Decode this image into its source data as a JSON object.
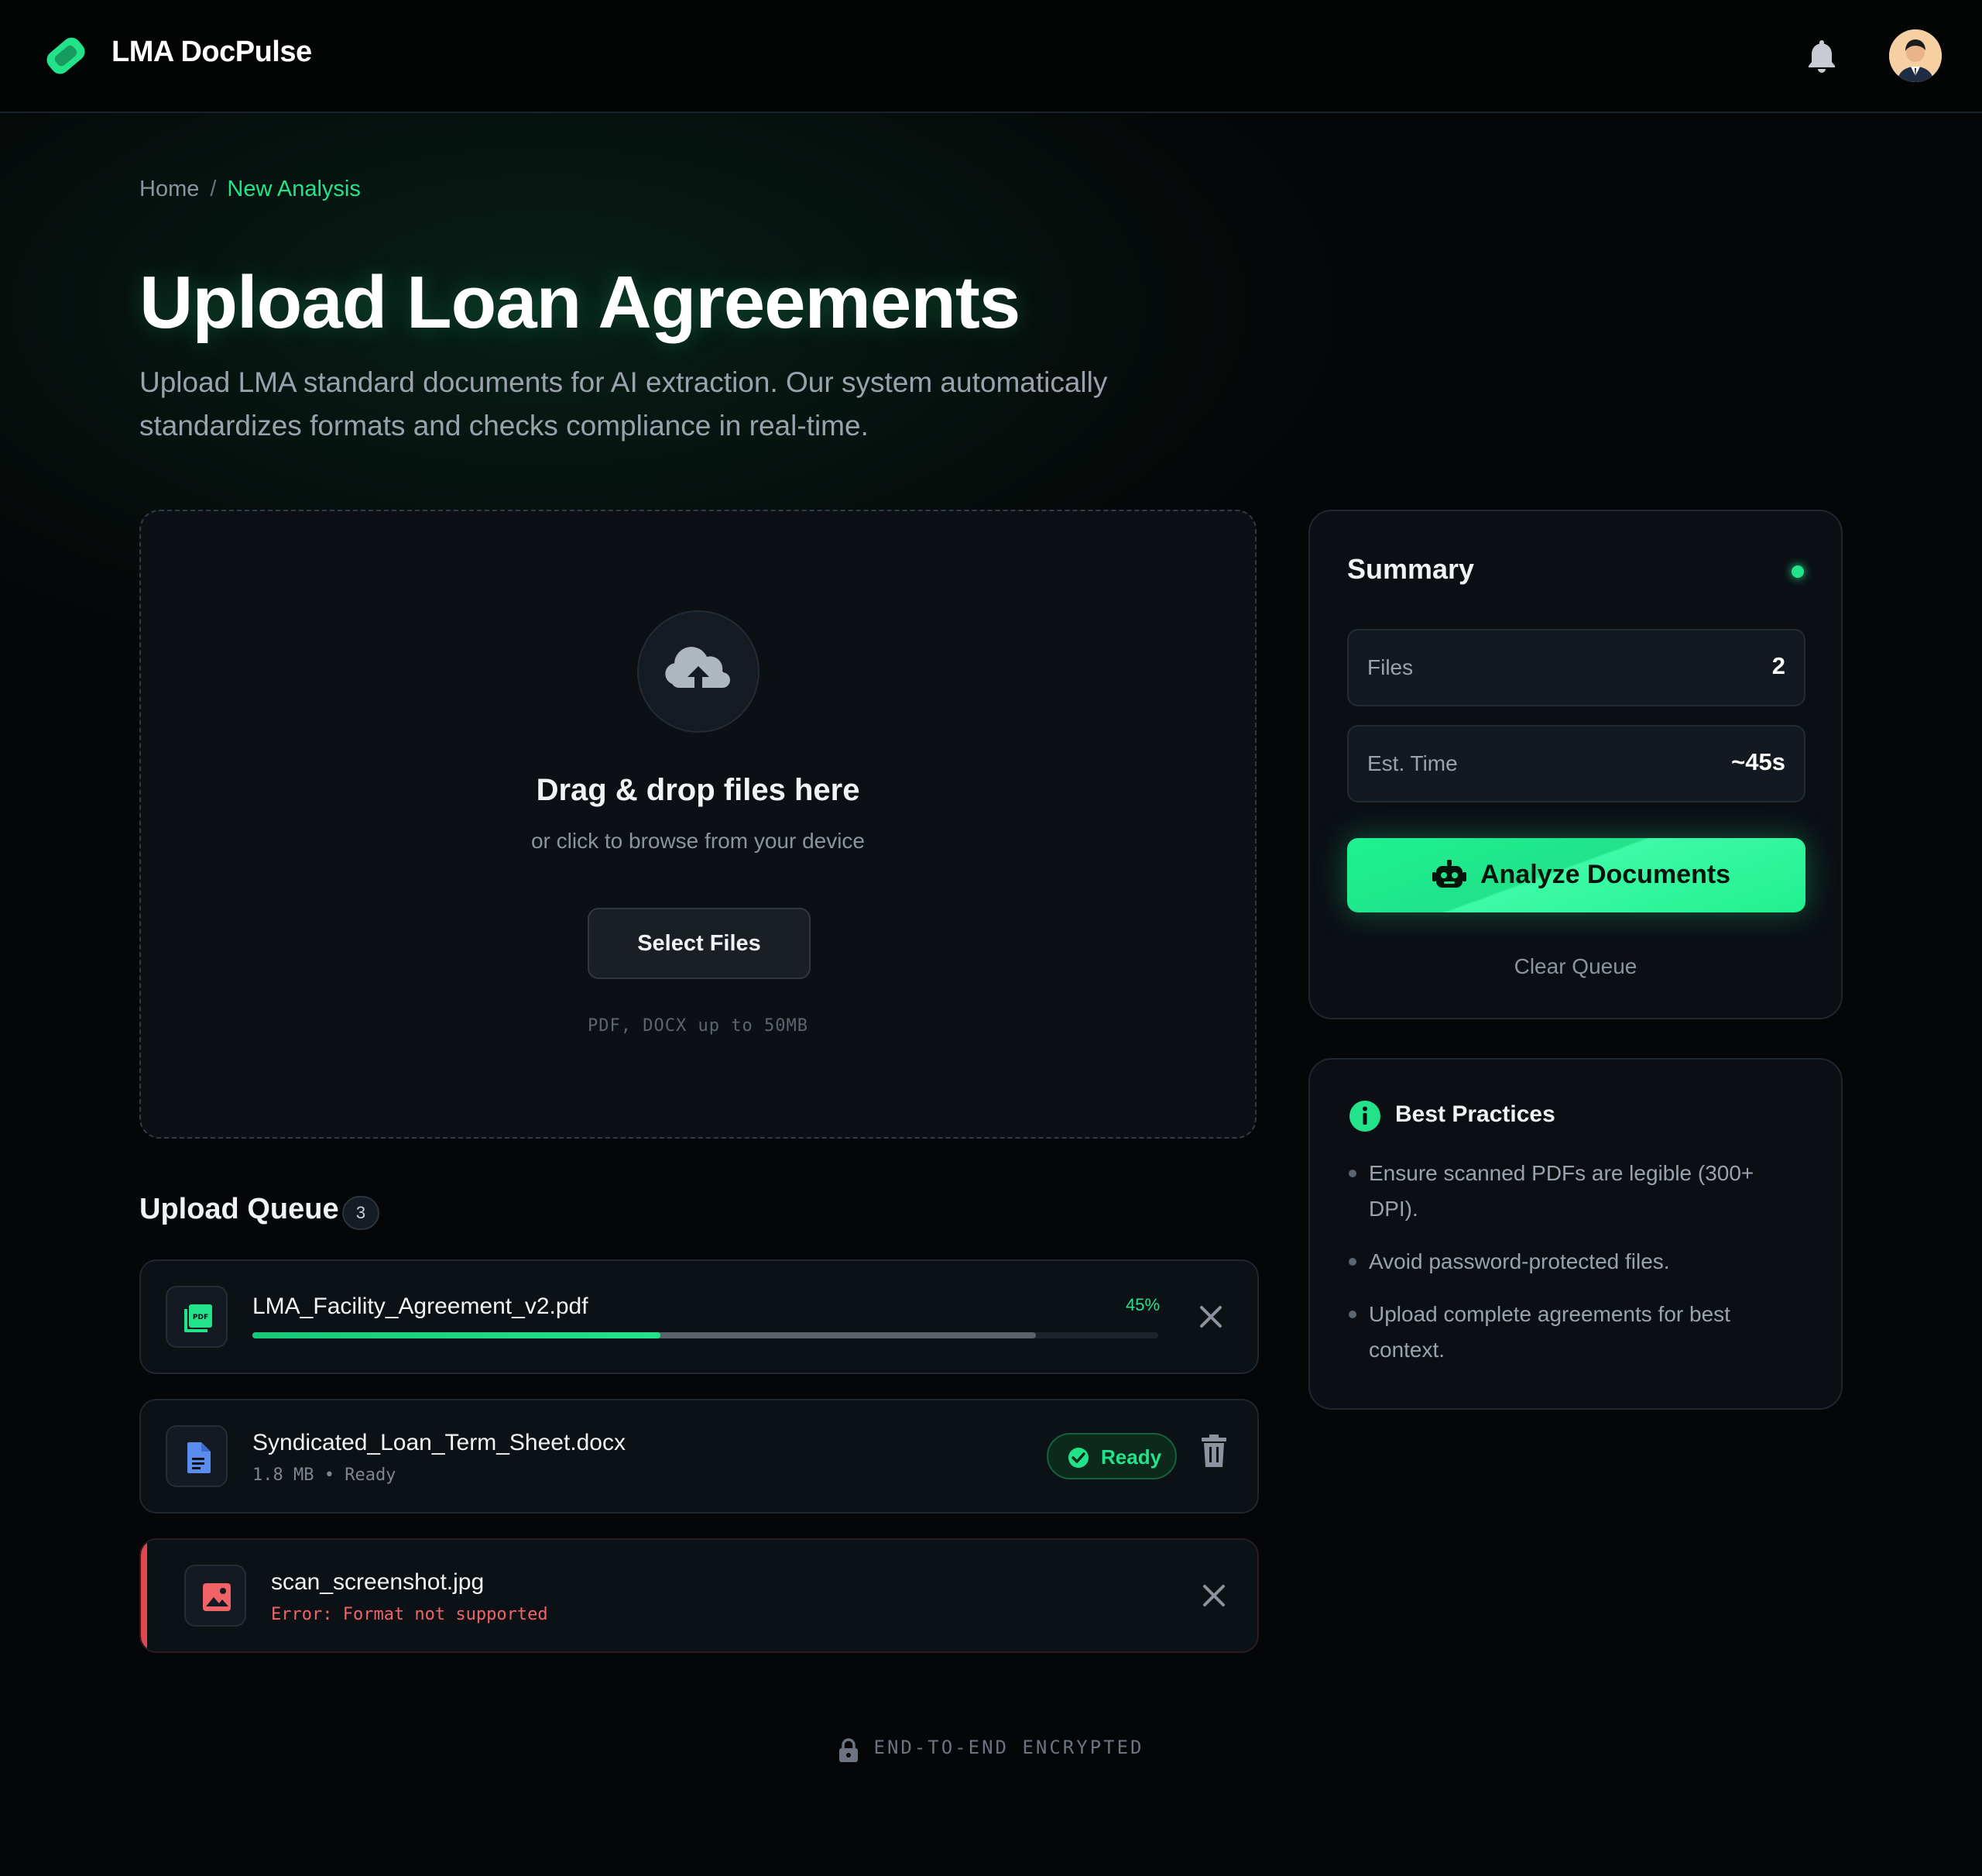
{
  "app": {
    "name": "LMA DocPulse"
  },
  "breadcrumb": {
    "home": "Home",
    "separator": "/",
    "current": "New Analysis"
  },
  "page": {
    "title": "Upload Loan Agreements",
    "description": "Upload LMA standard documents for AI extraction. Our system automatically standardizes formats and checks compliance in real-time."
  },
  "dropzone": {
    "title": "Drag & drop files here",
    "subtitle": "or click to browse from your device",
    "button_label": "Select Files",
    "hint": "PDF, DOCX up to 50MB",
    "icon": "cloud-upload-icon"
  },
  "queue": {
    "title": "Upload Queue",
    "count": "3",
    "items": [
      {
        "name": "LMA_Facility_Agreement_v2.pdf",
        "status": "uploading",
        "progress": 0.45,
        "progress_label": "45%",
        "icon": "pdf-file-icon"
      },
      {
        "name": "Syndicated_Loan_Term_Sheet.docx",
        "meta": "1.8 MB • Ready",
        "status": "ready",
        "badge": "Ready",
        "icon": "doc-file-icon"
      },
      {
        "name": "scan_screenshot.jpg",
        "meta": "Error: Format not supported",
        "status": "error",
        "icon": "image-file-icon"
      }
    ]
  },
  "summary": {
    "title": "Summary",
    "files_label": "Files",
    "files_value": "2",
    "time_label": "Est. Time",
    "time_value": "~45s",
    "analyze_label": "Analyze Documents",
    "clear_label": "Clear Queue"
  },
  "best_practices": {
    "title": "Best Practices",
    "items": [
      "Ensure scanned PDFs are legible (300+ DPI).",
      "Avoid password-protected files.",
      "Upload complete agreements for best context."
    ]
  },
  "footer": {
    "text": "END-TO-END ENCRYPTED"
  },
  "colors": {
    "accent": "#22e38a",
    "background": "#050607",
    "error": "#e0474f",
    "panel": "#0b0f14"
  }
}
